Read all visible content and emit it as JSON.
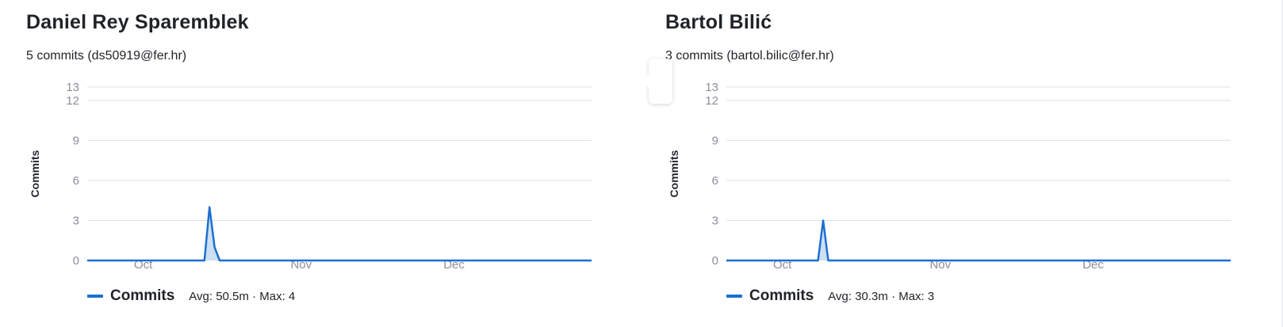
{
  "colors": {
    "series": "#1d6fd0",
    "area": "#c9dcf3",
    "grid": "#dfe1e5",
    "tick": "#8a8f98"
  },
  "authors": [
    {
      "name": "Daniel Rey Sparemblek",
      "meta": "5 commits (ds50919@fer.hr)",
      "legend_label": "Commits",
      "legend_stats": "Avg: 50.5m · Max: 4"
    },
    {
      "name": "Bartol Bilić",
      "meta": "3 commits (bartol.bilic@fer.hr)",
      "legend_label": "Commits",
      "legend_stats": "Avg: 30.3m · Max: 3"
    }
  ],
  "chart_data": [
    {
      "type": "area",
      "ylabel": "Commits",
      "ylim": [
        0,
        13
      ],
      "yticks": [
        0,
        3,
        6,
        9,
        12,
        13
      ],
      "x_range": [
        "2023-09-20",
        "2023-12-28"
      ],
      "xticks": [
        {
          "date": "2023-10-01",
          "label": "Oct"
        },
        {
          "date": "2023-11-01",
          "label": "Nov"
        },
        {
          "date": "2023-12-01",
          "label": "Dec"
        }
      ],
      "grid": true,
      "legend": "bottom-left",
      "series": [
        {
          "name": "Commits",
          "points": [
            [
              "2023-09-20",
              0
            ],
            [
              "2023-10-13",
              0
            ],
            [
              "2023-10-14",
              4
            ],
            [
              "2023-10-15",
              1
            ],
            [
              "2023-10-16",
              0
            ],
            [
              "2023-12-28",
              0
            ]
          ]
        }
      ]
    },
    {
      "type": "area",
      "ylabel": "Commits",
      "ylim": [
        0,
        13
      ],
      "yticks": [
        0,
        3,
        6,
        9,
        12,
        13
      ],
      "x_range": [
        "2023-09-20",
        "2023-12-28"
      ],
      "xticks": [
        {
          "date": "2023-10-01",
          "label": "Oct"
        },
        {
          "date": "2023-11-01",
          "label": "Nov"
        },
        {
          "date": "2023-12-01",
          "label": "Dec"
        }
      ],
      "grid": true,
      "legend": "bottom-left",
      "series": [
        {
          "name": "Commits",
          "points": [
            [
              "2023-09-20",
              0
            ],
            [
              "2023-10-08",
              0
            ],
            [
              "2023-10-09",
              3
            ],
            [
              "2023-10-10",
              0
            ],
            [
              "2023-12-28",
              0
            ]
          ]
        }
      ]
    }
  ]
}
